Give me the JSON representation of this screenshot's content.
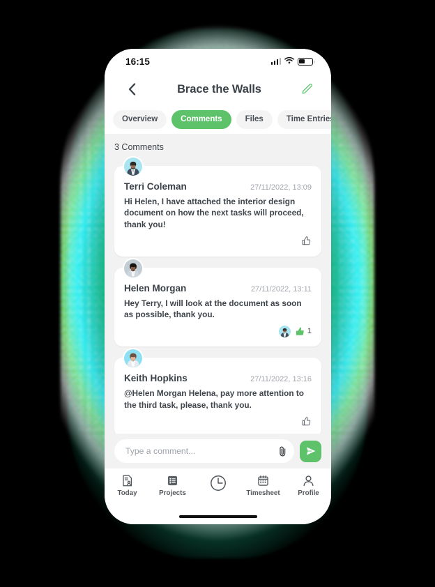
{
  "status_bar": {
    "time": "16:15",
    "signal_icon": "cellular-signal-icon",
    "wifi_icon": "wifi-icon",
    "battery_icon": "battery-icon"
  },
  "header": {
    "back_icon": "chevron-left-icon",
    "title": "Brace the Walls",
    "edit_icon": "pencil-edit-icon"
  },
  "tabs": [
    {
      "label": "Overview",
      "active": false
    },
    {
      "label": "Comments",
      "active": true
    },
    {
      "label": "Files",
      "active": false
    },
    {
      "label": "Time Entries",
      "active": false
    }
  ],
  "comments_section": {
    "count_label": "3 Comments",
    "comments": [
      {
        "author": "Terri Coleman",
        "timestamp": "27/11/2022, 13:09",
        "body": "Hi Helen, I have attached the interior design document on how the next tasks will proceed, thank you!",
        "avatar_icon": "avatar-terri-coleman",
        "like_icon": "thumbs-up-outline-icon",
        "liked": false,
        "like_count": "",
        "reactors": []
      },
      {
        "author": "Helen Morgan",
        "timestamp": "27/11/2022, 13:11",
        "body": "Hey Terry, I will look at the document as soon as possible, thank you.",
        "avatar_icon": "avatar-helen-morgan",
        "like_icon": "thumbs-up-filled-icon",
        "liked": true,
        "like_count": "1",
        "reactors": [
          "avatar-terri-coleman"
        ]
      },
      {
        "author": "Keith Hopkins",
        "timestamp": "27/11/2022, 13:16",
        "body": "@Helen Morgan Helena, pay more attention to the third task, please, thank you.",
        "avatar_icon": "avatar-keith-hopkins",
        "like_icon": "thumbs-up-outline-icon",
        "liked": false,
        "like_count": "",
        "reactors": []
      }
    ]
  },
  "composer": {
    "placeholder": "Type a comment...",
    "value": "",
    "attach_icon": "paperclip-icon",
    "send_icon": "send-paper-plane-icon"
  },
  "bottom_nav": [
    {
      "label": "Today",
      "icon": "today-document-icon"
    },
    {
      "label": "Projects",
      "icon": "projects-list-icon"
    },
    {
      "label": "",
      "icon": "clock-timer-icon"
    },
    {
      "label": "Timesheet",
      "icon": "calendar-timesheet-icon"
    },
    {
      "label": "Profile",
      "icon": "person-profile-icon"
    }
  ],
  "home_indicator": "home-indicator-bar",
  "colors": {
    "accent_green": "#5EC26A",
    "glow_green": "#22C98D",
    "glow_cyan": "#22E9FF",
    "page_background": "#000000",
    "screen_background": "#F2F2F3",
    "card_background": "#FFFFFF",
    "title_text": "#3B4148",
    "muted_text": "#A2A7AD"
  }
}
